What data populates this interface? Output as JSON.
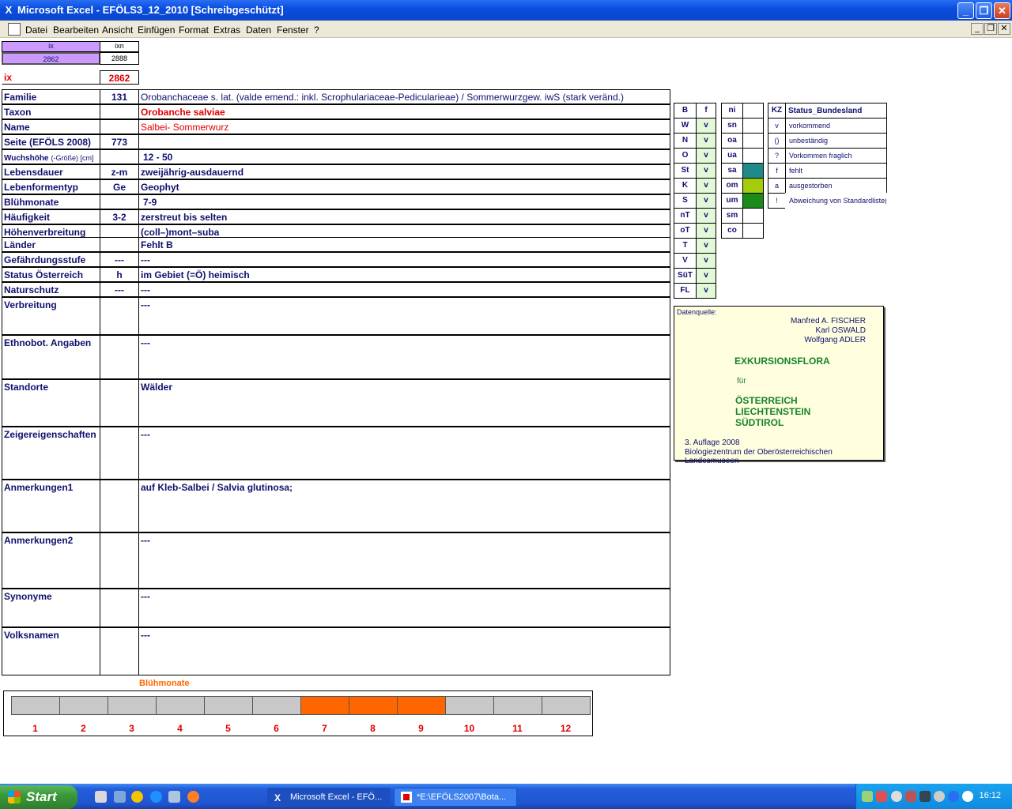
{
  "window": {
    "title": "Microsoft Excel - EFÖLS3_12_2010  [Schreibgeschützt]"
  },
  "menu": [
    "Datei",
    "Bearbeiten",
    "Ansicht",
    "Einfügen",
    "Format",
    "Extras",
    "Daten",
    "Fenster",
    "?"
  ],
  "top": {
    "ix_hdr": "ix",
    "ixn_hdr": "ixn",
    "ix_val": "2862",
    "ixn_val": "2888",
    "ix_label": "ix",
    "ix_big": "2862"
  },
  "fields": {
    "familie": {
      "label": "Familie",
      "mid": "131",
      "value": "Orobanchaceae s. lat. (valde emend.: inkl. Scrophulariaceae-Pedicularieae)  /  Sommerwurzgew. iwS (stark veränd.)"
    },
    "taxon": {
      "label": "Taxon",
      "mid": "",
      "value": "Orobanche salviae"
    },
    "name": {
      "label": "Name",
      "mid": "",
      "value": "Salbei- Sommerwurz"
    },
    "seite": {
      "label": "Seite (EFÖLS 2008)",
      "mid": "773",
      "value": ""
    },
    "wuchs": {
      "label": "Wuchshöhe",
      "label_small": "(-Größe) [cm]",
      "mid": "",
      "value": "12 - 50"
    },
    "lebensdauer": {
      "label": "Lebensdauer",
      "mid": "z-m",
      "value": "zweijährig-ausdauernd"
    },
    "lebensform": {
      "label": "Lebenformentyp",
      "mid": "Ge",
      "value": "Geophyt"
    },
    "bluehmonate": {
      "label": "Blühmonate",
      "mid": "",
      "value": "7-9"
    },
    "haeufigkeit": {
      "label": "Häufigkeit",
      "mid": "3-2",
      "value": "zerstreut bis selten"
    },
    "hoehen": {
      "label": "Höhenverbreitung",
      "mid": "",
      "value": "(coll–)mont–suba"
    },
    "laender": {
      "label": "Länder",
      "mid": "",
      "value": "Fehlt B"
    },
    "gefaehrdung": {
      "label": "Gefährdungsstufe",
      "mid": "---",
      "value": "---"
    },
    "status": {
      "label": "Status Österreich",
      "mid": "h",
      "value": "im Gebiet (=Ö) heimisch"
    },
    "naturschutz": {
      "label": "Naturschutz",
      "mid": "---",
      "value": "---"
    },
    "verbreitung": {
      "label": "Verbreitung",
      "value": "---"
    },
    "ethnobot": {
      "label": "Ethnobot. Angaben",
      "value": "---"
    },
    "standorte": {
      "label": "Standorte",
      "value": "Wälder"
    },
    "zeiger": {
      "label": "Zeigereigenschaften",
      "value": "---"
    },
    "anm1": {
      "label": "Anmerkungen1",
      "value": "auf Kleb-Salbei / Salvia glutinosa;"
    },
    "anm2": {
      "label": "Anmerkungen2",
      "value": "---"
    },
    "synonyme": {
      "label": "Synonyme",
      "value": "---"
    },
    "volksnamen": {
      "label": "Volksnamen",
      "value": "---"
    }
  },
  "bundesland": {
    "head": [
      "B",
      "f"
    ],
    "rows": [
      [
        "W",
        "v"
      ],
      [
        "N",
        "v"
      ],
      [
        "O",
        "v"
      ],
      [
        "St",
        "v"
      ],
      [
        "K",
        "v"
      ],
      [
        "S",
        "v"
      ],
      [
        "nT",
        "v"
      ],
      [
        "oT",
        "v"
      ],
      [
        "T",
        "v"
      ],
      [
        "V",
        "v"
      ],
      [
        "SüT",
        "v"
      ],
      [
        "FL",
        "v"
      ]
    ]
  },
  "regions": {
    "head": "ni",
    "rows": [
      {
        "k": "sn",
        "color": ""
      },
      {
        "k": "oa",
        "color": ""
      },
      {
        "k": "ua",
        "color": ""
      },
      {
        "k": "sa",
        "color": "#1f8a8a"
      },
      {
        "k": "om",
        "color": "#a3cc0c"
      },
      {
        "k": "um",
        "color": "#1a8a1a"
      },
      {
        "k": "sm",
        "color": ""
      },
      {
        "k": "co",
        "color": ""
      }
    ]
  },
  "status_legend": {
    "head_kz": "KZ",
    "head_title": "Status_Bundesland",
    "rows": [
      [
        "v",
        "vorkommend"
      ],
      [
        "()",
        "unbeständig"
      ],
      [
        "?",
        "Vorkommen fraglich"
      ],
      [
        "f",
        "fehlt"
      ],
      [
        "a",
        "ausgestorben"
      ],
      [
        "!",
        "Abweichung von Standardliste(?)"
      ]
    ]
  },
  "source": {
    "label": "Datenquelle:",
    "authors": [
      "Manfred A. FISCHER",
      "Karl OSWALD",
      "Wolfgang ADLER"
    ],
    "title": "EXKURSIONSFLORA",
    "fuer": "für",
    "countries": [
      "ÖSTERREICH",
      "LIECHTENSTEIN",
      "SÜDTIROL"
    ],
    "edition": "3. Auflage 2008",
    "publisher": "Biologiezentrum der Oberösterreichischen Landesmuseen"
  },
  "months": {
    "title": "Blühmonate",
    "labels": [
      "1",
      "2",
      "3",
      "4",
      "5",
      "6",
      "7",
      "8",
      "9",
      "10",
      "11",
      "12"
    ],
    "flowering": [
      7,
      8,
      9
    ],
    "active_color": "#ff6600",
    "inactive_color": "#c8c8c8"
  },
  "taskbar": {
    "start": "Start",
    "tasks": [
      "Microsoft Excel - EFÖ...",
      "*E:\\EFÖLS2007\\Bota..."
    ],
    "clock": "16:12"
  }
}
